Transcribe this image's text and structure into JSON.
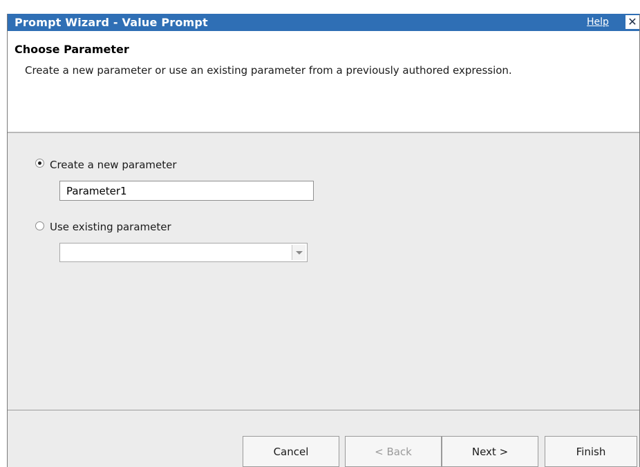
{
  "window": {
    "title": "Prompt Wizard - Value Prompt",
    "help_label": "Help",
    "close_glyph": "✕"
  },
  "header": {
    "section_title": "Choose Parameter",
    "description": "Create a new parameter or use an existing parameter from a previously authored expression."
  },
  "options": {
    "create_new": {
      "label": "Create a new parameter",
      "selected": true,
      "input_value": "Parameter1"
    },
    "use_existing": {
      "label": "Use existing parameter",
      "selected": false,
      "selected_value": ""
    }
  },
  "footer": {
    "cancel_label": "Cancel",
    "back_label": "< Back",
    "next_label": "Next >",
    "finish_label": "Finish"
  },
  "colors": {
    "titlebar": "#2f6fb5",
    "panel_bg": "#ececec",
    "header_bg": "#ffffff"
  }
}
